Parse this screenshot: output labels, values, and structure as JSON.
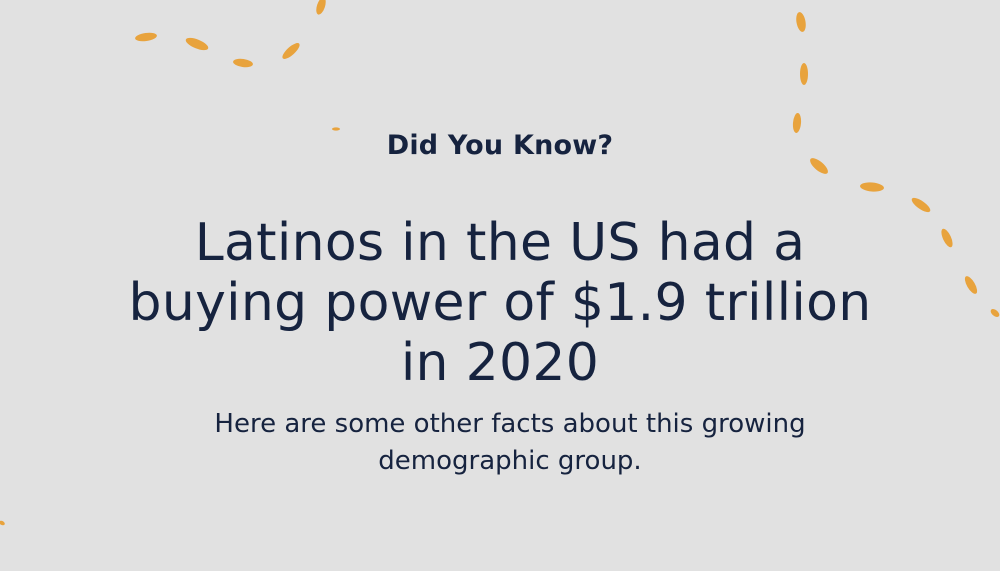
{
  "slide": {
    "kicker": "Did You Know?",
    "headline": "Latinos in the US had a buying power of $1.9 trillion in 2020",
    "subtext": "Here are some other facts about this growing demographic group."
  },
  "colors": {
    "background": "#e1e1e1",
    "text": "#16233f",
    "accent": "#e8a33d"
  }
}
